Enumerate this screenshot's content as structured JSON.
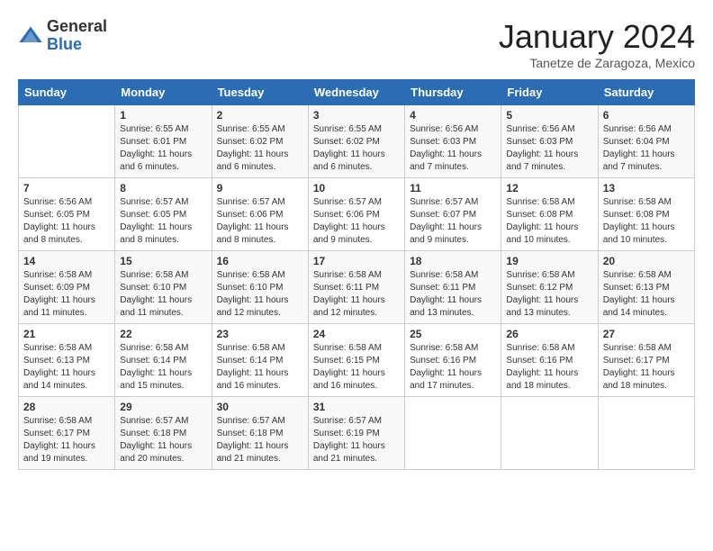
{
  "logo": {
    "general": "General",
    "blue": "Blue"
  },
  "title": "January 2024",
  "location": "Tanetze de Zaragoza, Mexico",
  "weekdays": [
    "Sunday",
    "Monday",
    "Tuesday",
    "Wednesday",
    "Thursday",
    "Friday",
    "Saturday"
  ],
  "weeks": [
    [
      {
        "day": "",
        "sunrise": "",
        "sunset": "",
        "daylight": ""
      },
      {
        "day": "1",
        "sunrise": "Sunrise: 6:55 AM",
        "sunset": "Sunset: 6:01 PM",
        "daylight": "Daylight: 11 hours and 6 minutes."
      },
      {
        "day": "2",
        "sunrise": "Sunrise: 6:55 AM",
        "sunset": "Sunset: 6:02 PM",
        "daylight": "Daylight: 11 hours and 6 minutes."
      },
      {
        "day": "3",
        "sunrise": "Sunrise: 6:55 AM",
        "sunset": "Sunset: 6:02 PM",
        "daylight": "Daylight: 11 hours and 6 minutes."
      },
      {
        "day": "4",
        "sunrise": "Sunrise: 6:56 AM",
        "sunset": "Sunset: 6:03 PM",
        "daylight": "Daylight: 11 hours and 7 minutes."
      },
      {
        "day": "5",
        "sunrise": "Sunrise: 6:56 AM",
        "sunset": "Sunset: 6:03 PM",
        "daylight": "Daylight: 11 hours and 7 minutes."
      },
      {
        "day": "6",
        "sunrise": "Sunrise: 6:56 AM",
        "sunset": "Sunset: 6:04 PM",
        "daylight": "Daylight: 11 hours and 7 minutes."
      }
    ],
    [
      {
        "day": "7",
        "sunrise": "Sunrise: 6:56 AM",
        "sunset": "Sunset: 6:05 PM",
        "daylight": "Daylight: 11 hours and 8 minutes."
      },
      {
        "day": "8",
        "sunrise": "Sunrise: 6:57 AM",
        "sunset": "Sunset: 6:05 PM",
        "daylight": "Daylight: 11 hours and 8 minutes."
      },
      {
        "day": "9",
        "sunrise": "Sunrise: 6:57 AM",
        "sunset": "Sunset: 6:06 PM",
        "daylight": "Daylight: 11 hours and 8 minutes."
      },
      {
        "day": "10",
        "sunrise": "Sunrise: 6:57 AM",
        "sunset": "Sunset: 6:06 PM",
        "daylight": "Daylight: 11 hours and 9 minutes."
      },
      {
        "day": "11",
        "sunrise": "Sunrise: 6:57 AM",
        "sunset": "Sunset: 6:07 PM",
        "daylight": "Daylight: 11 hours and 9 minutes."
      },
      {
        "day": "12",
        "sunrise": "Sunrise: 6:58 AM",
        "sunset": "Sunset: 6:08 PM",
        "daylight": "Daylight: 11 hours and 10 minutes."
      },
      {
        "day": "13",
        "sunrise": "Sunrise: 6:58 AM",
        "sunset": "Sunset: 6:08 PM",
        "daylight": "Daylight: 11 hours and 10 minutes."
      }
    ],
    [
      {
        "day": "14",
        "sunrise": "Sunrise: 6:58 AM",
        "sunset": "Sunset: 6:09 PM",
        "daylight": "Daylight: 11 hours and 11 minutes."
      },
      {
        "day": "15",
        "sunrise": "Sunrise: 6:58 AM",
        "sunset": "Sunset: 6:10 PM",
        "daylight": "Daylight: 11 hours and 11 minutes."
      },
      {
        "day": "16",
        "sunrise": "Sunrise: 6:58 AM",
        "sunset": "Sunset: 6:10 PM",
        "daylight": "Daylight: 11 hours and 12 minutes."
      },
      {
        "day": "17",
        "sunrise": "Sunrise: 6:58 AM",
        "sunset": "Sunset: 6:11 PM",
        "daylight": "Daylight: 11 hours and 12 minutes."
      },
      {
        "day": "18",
        "sunrise": "Sunrise: 6:58 AM",
        "sunset": "Sunset: 6:11 PM",
        "daylight": "Daylight: 11 hours and 13 minutes."
      },
      {
        "day": "19",
        "sunrise": "Sunrise: 6:58 AM",
        "sunset": "Sunset: 6:12 PM",
        "daylight": "Daylight: 11 hours and 13 minutes."
      },
      {
        "day": "20",
        "sunrise": "Sunrise: 6:58 AM",
        "sunset": "Sunset: 6:13 PM",
        "daylight": "Daylight: 11 hours and 14 minutes."
      }
    ],
    [
      {
        "day": "21",
        "sunrise": "Sunrise: 6:58 AM",
        "sunset": "Sunset: 6:13 PM",
        "daylight": "Daylight: 11 hours and 14 minutes."
      },
      {
        "day": "22",
        "sunrise": "Sunrise: 6:58 AM",
        "sunset": "Sunset: 6:14 PM",
        "daylight": "Daylight: 11 hours and 15 minutes."
      },
      {
        "day": "23",
        "sunrise": "Sunrise: 6:58 AM",
        "sunset": "Sunset: 6:14 PM",
        "daylight": "Daylight: 11 hours and 16 minutes."
      },
      {
        "day": "24",
        "sunrise": "Sunrise: 6:58 AM",
        "sunset": "Sunset: 6:15 PM",
        "daylight": "Daylight: 11 hours and 16 minutes."
      },
      {
        "day": "25",
        "sunrise": "Sunrise: 6:58 AM",
        "sunset": "Sunset: 6:16 PM",
        "daylight": "Daylight: 11 hours and 17 minutes."
      },
      {
        "day": "26",
        "sunrise": "Sunrise: 6:58 AM",
        "sunset": "Sunset: 6:16 PM",
        "daylight": "Daylight: 11 hours and 18 minutes."
      },
      {
        "day": "27",
        "sunrise": "Sunrise: 6:58 AM",
        "sunset": "Sunset: 6:17 PM",
        "daylight": "Daylight: 11 hours and 18 minutes."
      }
    ],
    [
      {
        "day": "28",
        "sunrise": "Sunrise: 6:58 AM",
        "sunset": "Sunset: 6:17 PM",
        "daylight": "Daylight: 11 hours and 19 minutes."
      },
      {
        "day": "29",
        "sunrise": "Sunrise: 6:57 AM",
        "sunset": "Sunset: 6:18 PM",
        "daylight": "Daylight: 11 hours and 20 minutes."
      },
      {
        "day": "30",
        "sunrise": "Sunrise: 6:57 AM",
        "sunset": "Sunset: 6:18 PM",
        "daylight": "Daylight: 11 hours and 21 minutes."
      },
      {
        "day": "31",
        "sunrise": "Sunrise: 6:57 AM",
        "sunset": "Sunset: 6:19 PM",
        "daylight": "Daylight: 11 hours and 21 minutes."
      },
      {
        "day": "",
        "sunrise": "",
        "sunset": "",
        "daylight": ""
      },
      {
        "day": "",
        "sunrise": "",
        "sunset": "",
        "daylight": ""
      },
      {
        "day": "",
        "sunrise": "",
        "sunset": "",
        "daylight": ""
      }
    ]
  ]
}
